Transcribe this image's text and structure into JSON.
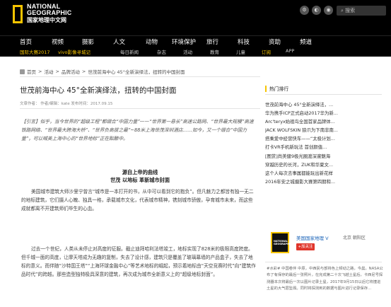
{
  "brand": {
    "line1": "NATIONAL",
    "line2": "GEOGRAPHIC",
    "line3": "国家地理中文网"
  },
  "header": {
    "search_placeholder": "搜索"
  },
  "nav_main": [
    "首页",
    "视频",
    "摄影",
    "人文",
    "动物",
    "环境保护",
    "旅行",
    "科技",
    "资助",
    "频道"
  ],
  "nav_sub": [
    "国际大赛2017",
    "vivo影像寻城记",
    "每日新闻",
    "杂志",
    "活动",
    "教育",
    "儿童",
    "订阅",
    "APP"
  ],
  "breadcrumb": [
    "首页",
    "活动",
    "品牌活动",
    "世茂前海中心 45°全新演绎法，扭转的中国封面"
  ],
  "article": {
    "title": "世茂前海中心 45°全新演绎法，扭转的中国封面",
    "meta": "文章作者：   作者/编辑：kate    发布时间：2017.09.15",
    "lead": "【引言】似乎，当今世界的“超级工程”都缀合“中国力量”——“世界第一悬长”高速公路网、“世界最大规模”高速铁路网络、“世界最大跨海大桥”、“世界负高拔之最”~88米上海世茂深圳酒店……如今，又一个缀合“中国力量”，可以喊美上海中心的“世界地标”正在酝酿中。",
    "subhead1": "源自上帝的曲线",
    "subhead2": "世茂 以地标 革新城市封面",
    "p1": "美国城市建筑大师沙里宁曾言“城市是一本打开的书，从中可以看到它的抱负”。但凡魅力之都皆有独一无二的地标建筑，它们摄人心魄、独具一格，承载城市文化，代表城市精神，镌刻城市骄傲，孕育城市未来，而这些成就都离不开建筑师们毕生的心血。",
    "p2": "过去一个世纪，人类从未停止对高度的征服。截止迪拜哈利法塔竣工，地标实现了828米的极限高度跨度。但千城一面的高度，让摩天塔成为无趣的复制，失去了设计感，建筑只是覆盖了玻璃幕墙的产品盒子，失去了地标的意义。而伴随“沙特国王塔”“上海环球金融中心”等艺术地标的崛起，预示着地标由“天空竞赛时代”向“建筑作品时代”的跨越。那些造型独特极具深意的建筑，再次成为城市全新意义上的“超级地标封面”。"
  },
  "sidebar": {
    "title": "热门排行",
    "ranked": [
      "世茂前海中心 45°全新演绎法，...",
      "华为携手ICP正式启动2017华为新...",
      "Arc'teryx始祖鸟全国首家品牌体...",
      "JACK WOLFSKIN 狼爪为下南非南...",
      "搭乘爱中经营快车——“太极计划...",
      "打卡VR手机新玩法 首创颜值...",
      "[图赏]尚美健9极光圈渡深邃魅海",
      "穿越历史的长河，ZUK和华夏文...",
      "这个人每次去事属都能玩出新花样",
      "2016年安之城摄影大赛第四期和..."
    ]
  },
  "weibo": {
    "logo_text": "NATIONAL GEOGRAPHIC",
    "name": "美国国家地理 V",
    "location": "北京 朝阳区",
    "follow": "+加关注",
    "post": "#水彩# 中国卷伴 中原，中西民与部将色上频动之路，今晨，NASA公布了有保存的最后一张照片，在完成第二十次飞越土星后，卡西尼号探测器本次将最后一次以图片记录土星，2017年9月15日以后它将撞进土星的大气层坠毁。同时将探测到的数据与图片进行记录保存..."
  },
  "colors": {
    "accent": "#f6c400",
    "header_bg": "#000000",
    "follow_red": "#e0352b",
    "weibo_blue": "#1a63b8"
  }
}
